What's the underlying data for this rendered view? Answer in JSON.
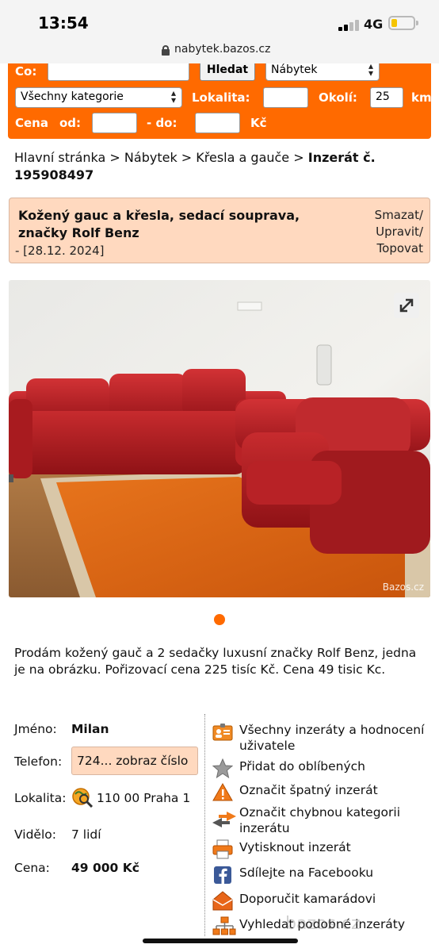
{
  "status_bar": {
    "time": "13:54",
    "network": "4G"
  },
  "browser": {
    "url": "nabytek.bazos.cz"
  },
  "search_form": {
    "co_label": "Co:",
    "co_value": "",
    "search_button": "Hledat",
    "section_select": "Nábytek",
    "category_select": "Všechny kategorie",
    "lokalita_label": "Lokalita:",
    "lokalita_value": "",
    "okoli_label": "Okolí:",
    "okoli_value": "25",
    "km_label": "km",
    "cena_label": "Cena",
    "od_label": "od:",
    "od_value": "",
    "do_label": "- do:",
    "do_value": "",
    "currency_label": "Kč"
  },
  "breadcrumb": {
    "home": "Hlavní stránka",
    "sep": " > ",
    "section": "Nábytek",
    "category": "Křesla a gauče",
    "current": "Inzerát č. 195908497"
  },
  "listing": {
    "title": "Kožený gauc a křesla, sedací souprava, značky Rolf Benz",
    "date": "- [28.12. 2024]",
    "action_delete": "Smazat/",
    "action_edit": "Upravit/",
    "action_top": "Topovat",
    "photo_watermark": "Bazos.cz",
    "description": "Prodám kožený gauč a 2 sedačky luxusní značky Rolf Benz, jedna je na obrázku. Pořizovací cena 225 tisíc Kč. Cena 49 tisic Kc."
  },
  "details": {
    "name_label": "Jméno:",
    "name_value": "Milan",
    "phone_label": "Telefon:",
    "phone_value": "724... zobraz číslo",
    "location_label": "Lokalita:",
    "location_value": "110 00 Praha 1",
    "seen_label": "Vidělo:",
    "seen_value": "7 lidí",
    "price_label": "Cena:",
    "price_value": "49 000 Kč"
  },
  "actions": [
    {
      "label": "Všechny inzeráty a hodnocení uživatele",
      "icon": "user-card-icon"
    },
    {
      "label": "Přidat do oblíbených",
      "icon": "star-icon"
    },
    {
      "label": "Označit špatný inzerát",
      "icon": "warning-icon"
    },
    {
      "label": "Označit chybnou kategorii inzerátu",
      "icon": "arrows-icon"
    },
    {
      "label": "Vytisknout inzerát",
      "icon": "printer-icon"
    },
    {
      "label": "Sdílejte na Facebooku",
      "icon": "facebook-icon"
    },
    {
      "label": "Doporučit kamarádovi",
      "icon": "envelope-icon"
    },
    {
      "label": "Vyhledat podobné inzeráty",
      "icon": "sitemap-icon"
    }
  ],
  "bottom_watermark": "bazos.cz",
  "colors": {
    "accent": "#ff6a00",
    "highlight_bg": "#ffd9bf"
  }
}
